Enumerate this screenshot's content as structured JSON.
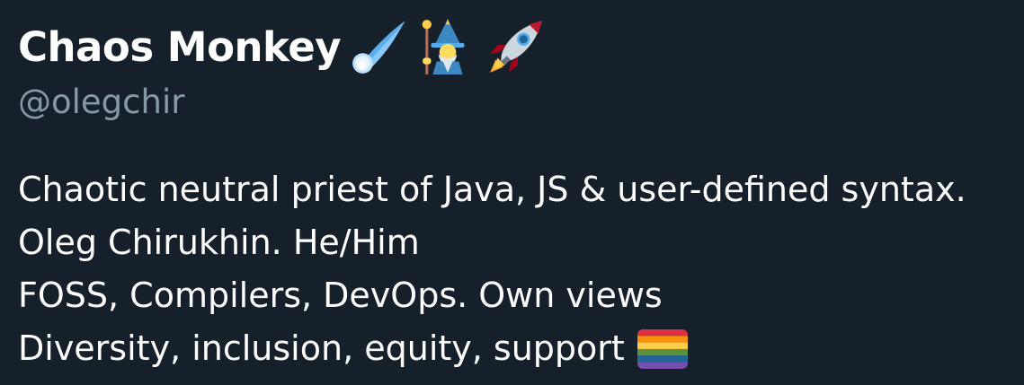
{
  "profile": {
    "display_name": "Chaos Monkey",
    "name_emojis": [
      "comet-icon",
      "mage-icon",
      "rocket-icon"
    ],
    "handle": "@olegchir",
    "bio_lines": [
      "Chaotic neutral priest of Java, JS & user-defined syntax.",
      "Oleg Chirukhin. He/Him",
      "FOSS, Compilers, DevOps. Own views",
      "Diversity, inclusion, equity, support"
    ],
    "bio_trailing_emoji": "rainbow-flag-icon"
  },
  "colors": {
    "background": "#15202b",
    "name_text": "#ffffff",
    "handle_text": "#8899a6",
    "bio_text": "#ffffff"
  }
}
